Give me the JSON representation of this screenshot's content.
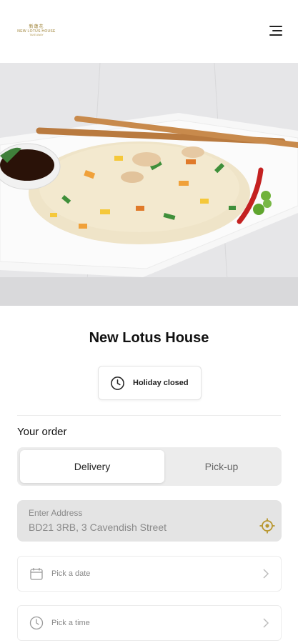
{
  "header": {
    "logo_glyphs": "新蓮花",
    "logo_name": "NEW LOTUS HOUSE",
    "logo_sub": "TAKE AWAY",
    "menu_icon": "hamburger-menu-icon"
  },
  "hero": {
    "image": "egg fried rice with chopsticks and soy sauce dish"
  },
  "restaurant": {
    "name": "New Lotus House",
    "status_label": "Holiday closed",
    "status_icon": "clock-icon"
  },
  "order": {
    "label": "Your order",
    "tabs": [
      {
        "label": "Delivery",
        "active": true
      },
      {
        "label": "Pick-up",
        "active": false
      }
    ],
    "address": {
      "placeholder": "Enter Address",
      "value": "BD21 3RB, 3 Cavendish Street",
      "icon": "locate-target-icon"
    },
    "date_picker": {
      "label": "Pick a date",
      "icon": "calendar-icon"
    },
    "time_picker": {
      "label": "Pick a time",
      "icon": "clock-icon"
    }
  },
  "colors": {
    "accent_gold": "#b8962e",
    "toggle_bg": "#ececec",
    "address_bg": "#e4e4e4"
  }
}
